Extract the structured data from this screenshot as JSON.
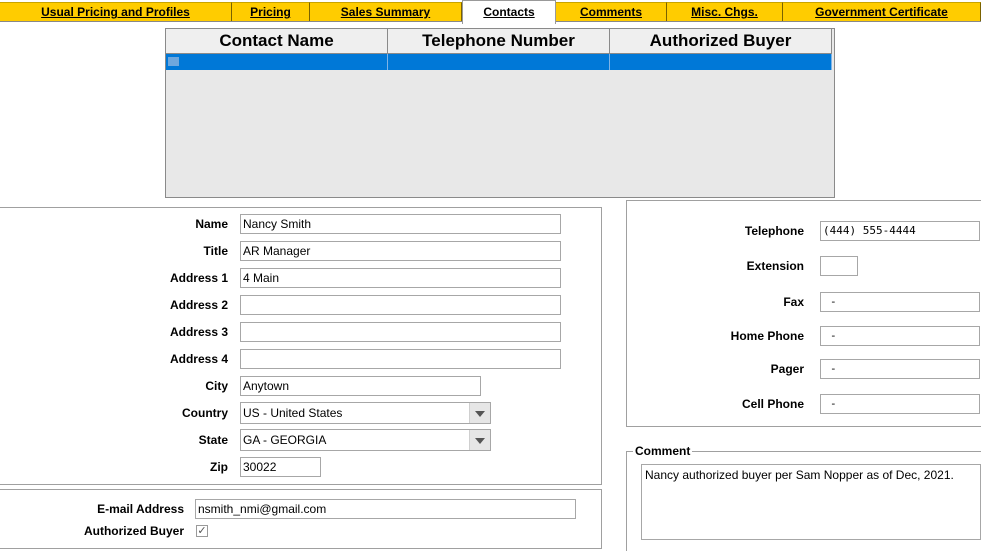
{
  "tabs": [
    {
      "label": "Usual Pricing and Profiles"
    },
    {
      "label": "Pricing"
    },
    {
      "label": "Sales Summary"
    },
    {
      "label": "Contacts"
    },
    {
      "label": "Comments"
    },
    {
      "label": "Misc. Chgs."
    },
    {
      "label": "Government Certificate"
    }
  ],
  "grid": {
    "columns": [
      "Contact Name",
      "Telephone Number",
      "Authorized Buyer"
    ],
    "rows": [
      [
        "",
        "",
        ""
      ]
    ]
  },
  "contact": {
    "labels": {
      "name": "Name",
      "title": "Title",
      "address1": "Address 1",
      "address2": "Address 2",
      "address3": "Address 3",
      "address4": "Address 4",
      "city": "City",
      "country": "Country",
      "state": "State",
      "zip": "Zip"
    },
    "values": {
      "name": "Nancy Smith",
      "title": "AR Manager",
      "address1": "4 Main",
      "address2": "",
      "address3": "",
      "address4": "",
      "city": "Anytown",
      "country": "US - United States",
      "state": "GA - GEORGIA",
      "zip": "30022"
    }
  },
  "email": {
    "label": "E-mail Address",
    "value": "nsmith_nmi@gmail.com"
  },
  "authorized_buyer": {
    "label": "Authorized Buyer",
    "checked": true,
    "mark": "✓"
  },
  "phones": {
    "labels": {
      "telephone": "Telephone",
      "extension": "Extension",
      "fax": "Fax",
      "home": "Home Phone",
      "pager": "Pager",
      "cell": "Cell Phone"
    },
    "values": {
      "telephone": "(444) 555-4444",
      "extension": "",
      "fax": "-",
      "home": "-",
      "pager": "-",
      "cell": "-"
    }
  },
  "comment": {
    "legend": "Comment",
    "text": "Nancy authorized buyer per Sam Nopper as of Dec, 2021."
  },
  "colors": {
    "tab": "#ffcc00",
    "selection": "#0078d7"
  }
}
